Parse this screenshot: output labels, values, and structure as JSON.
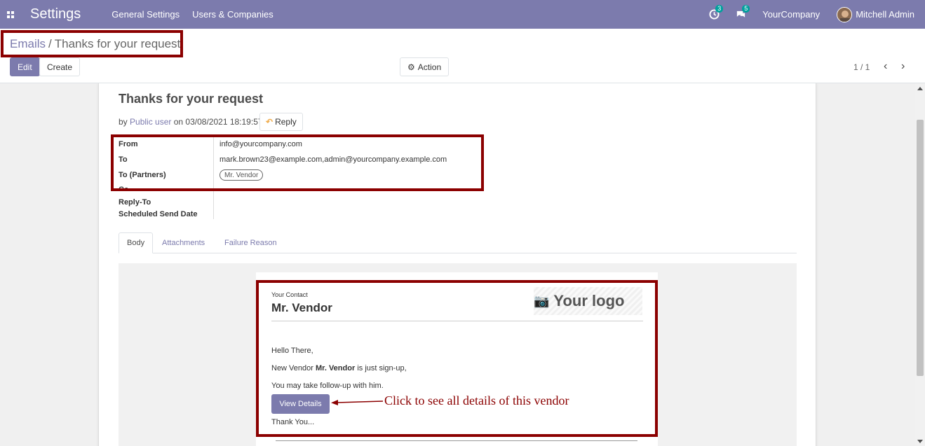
{
  "navbar": {
    "app_title": "Settings",
    "menu": [
      "General Settings",
      "Users & Companies"
    ],
    "activity_count": "3",
    "message_count": "5",
    "company": "YourCompany",
    "user": "Mitchell Admin"
  },
  "breadcrumb": {
    "parent": "Emails",
    "separator": "/",
    "current": "Thanks for your request"
  },
  "toolbar": {
    "edit_label": "Edit",
    "create_label": "Create",
    "action_label": "Action",
    "pager": "1 / 1"
  },
  "mail": {
    "subject": "Thanks for your request",
    "by_prefix": "by",
    "author": "Public user",
    "date_text": "on 03/08/2021 18:19:57",
    "reply_label": "Reply",
    "fields": {
      "from_label": "From",
      "from_value": "info@yourcompany.com",
      "to_label": "To",
      "to_value": "mark.brown23@example.com,admin@yourcompany.example.com",
      "to_partners_label": "To (Partners)",
      "to_partners_value": "Mr. Vendor",
      "cc_label": "Cc",
      "reply_to_label": "Reply-To",
      "scheduled_label": "Scheduled Send Date"
    },
    "tabs": [
      "Body",
      "Attachments",
      "Failure Reason"
    ],
    "active_tab": "Body"
  },
  "body": {
    "your_contact": "Your Contact",
    "vendor_name": "Mr. Vendor",
    "logo_text": "Your logo",
    "greeting": "Hello There,",
    "line1_prefix": "New Vendor",
    "line1_bold": "Mr. Vendor",
    "line1_suffix": "is just sign-up,",
    "line2": "You may take follow-up with him.",
    "button_label": "View Details",
    "closing": "Thank You..."
  },
  "annotation": {
    "text": "Click to see all details of this vendor",
    "color": "#8b0000"
  },
  "colors": {
    "brand": "#7c7bad",
    "badge": "#00a09d",
    "highlight": "#8b0000"
  }
}
